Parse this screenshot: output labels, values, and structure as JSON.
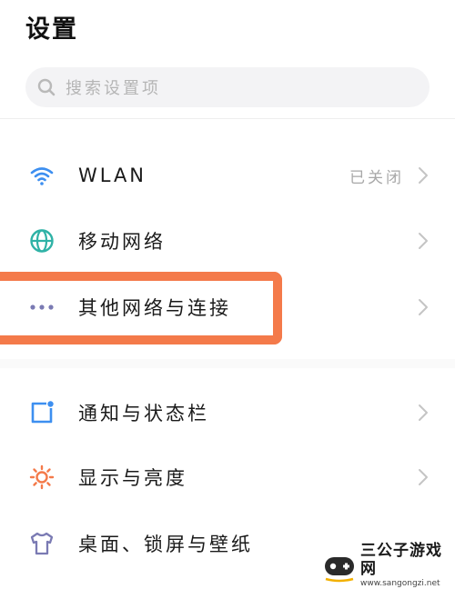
{
  "header": {
    "title": "设置"
  },
  "search": {
    "placeholder": "搜索设置项"
  },
  "groups": [
    {
      "items": [
        {
          "label": "WLAN",
          "status": "已关闭",
          "icon": "wifi-icon"
        },
        {
          "label": "移动网络",
          "icon": "globe-icon"
        },
        {
          "label": "其他网络与连接",
          "icon": "more-dots-icon",
          "highlighted": true
        }
      ]
    },
    {
      "items": [
        {
          "label": "通知与状态栏",
          "icon": "notification-icon"
        },
        {
          "label": "显示与亮度",
          "icon": "brightness-icon"
        },
        {
          "label": "桌面、锁屏与壁纸",
          "icon": "tshirt-icon"
        }
      ]
    }
  ],
  "watermark": {
    "title": "三公子游戏网",
    "url": "www.sangongzi.net"
  },
  "colors": {
    "accent_blue": "#3d8ff0",
    "accent_teal": "#2fb2a6",
    "accent_orange": "#f47a4a",
    "dots_purple": "#7a7ab3",
    "highlight_border": "#f47a4a"
  }
}
